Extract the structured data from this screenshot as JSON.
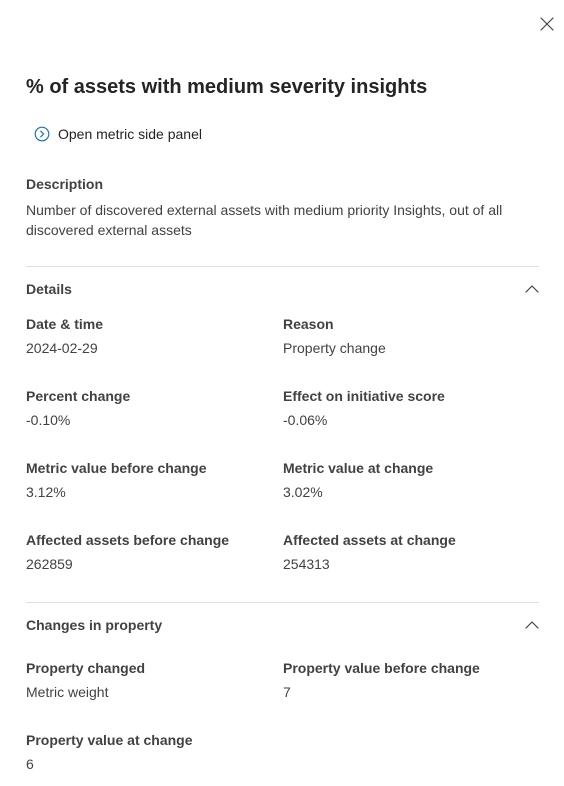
{
  "panel": {
    "title": "% of assets with medium severity insights",
    "open_link_label": "Open metric side panel"
  },
  "description": {
    "label": "Description",
    "text": "Number of discovered external assets with medium priority Insights, out of all discovered external assets"
  },
  "details": {
    "header": "Details",
    "fields": [
      {
        "label": "Date & time",
        "value": "2024-02-29"
      },
      {
        "label": "Reason",
        "value": "Property change"
      },
      {
        "label": "Percent change",
        "value": "-0.10%"
      },
      {
        "label": "Effect on initiative score",
        "value": "-0.06%"
      },
      {
        "label": "Metric value before change",
        "value": "3.12%"
      },
      {
        "label": "Metric value at change",
        "value": "3.02%"
      },
      {
        "label": "Affected assets before change",
        "value": "262859"
      },
      {
        "label": "Affected assets at change",
        "value": "254313"
      }
    ]
  },
  "changes": {
    "header": "Changes in property",
    "fields": [
      {
        "label": "Property changed",
        "value": "Metric weight"
      },
      {
        "label": "Property value before change",
        "value": "7"
      },
      {
        "label": "Property value at change",
        "value": "6"
      }
    ]
  },
  "icons": {
    "close": "close-icon",
    "open_link": "chevron-right-circle-icon",
    "collapse": "chevron-up-icon"
  },
  "colors": {
    "link_icon": "#0f6cbd",
    "text": "#242424",
    "divider": "#e0e0e0"
  }
}
